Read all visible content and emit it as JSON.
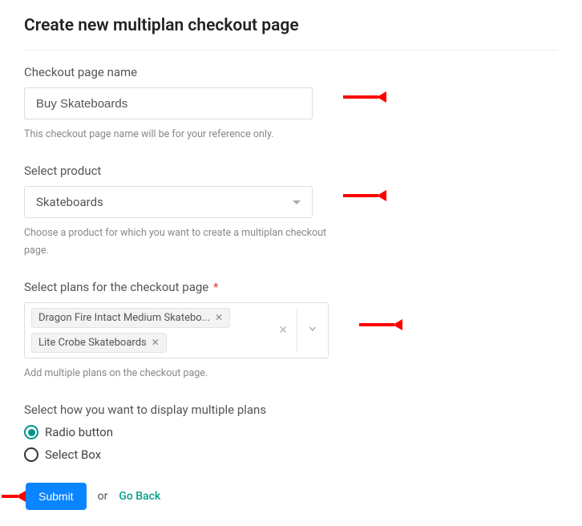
{
  "page": {
    "title": "Create new multiplan checkout page"
  },
  "fields": {
    "name": {
      "label": "Checkout page name",
      "value": "Buy Skateboards",
      "help": "This checkout page name will be for your reference only."
    },
    "product": {
      "label": "Select product",
      "value": "Skateboards",
      "help": "Choose a product for which you want to create a multiplan checkout page."
    },
    "plans": {
      "label": "Select plans for the checkout page",
      "required_marker": "*",
      "chips": [
        {
          "label": "Dragon Fire Intact Medium Skatebo..."
        },
        {
          "label": "Lite Crobe Skateboards"
        }
      ],
      "help": "Add multiple plans on the checkout page."
    },
    "display": {
      "label": "Select how you want to display multiple plans",
      "options": [
        {
          "label": "Radio button",
          "selected": true
        },
        {
          "label": "Select Box",
          "selected": false
        }
      ]
    }
  },
  "actions": {
    "submit": "Submit",
    "or": "or",
    "go_back": "Go Back"
  }
}
